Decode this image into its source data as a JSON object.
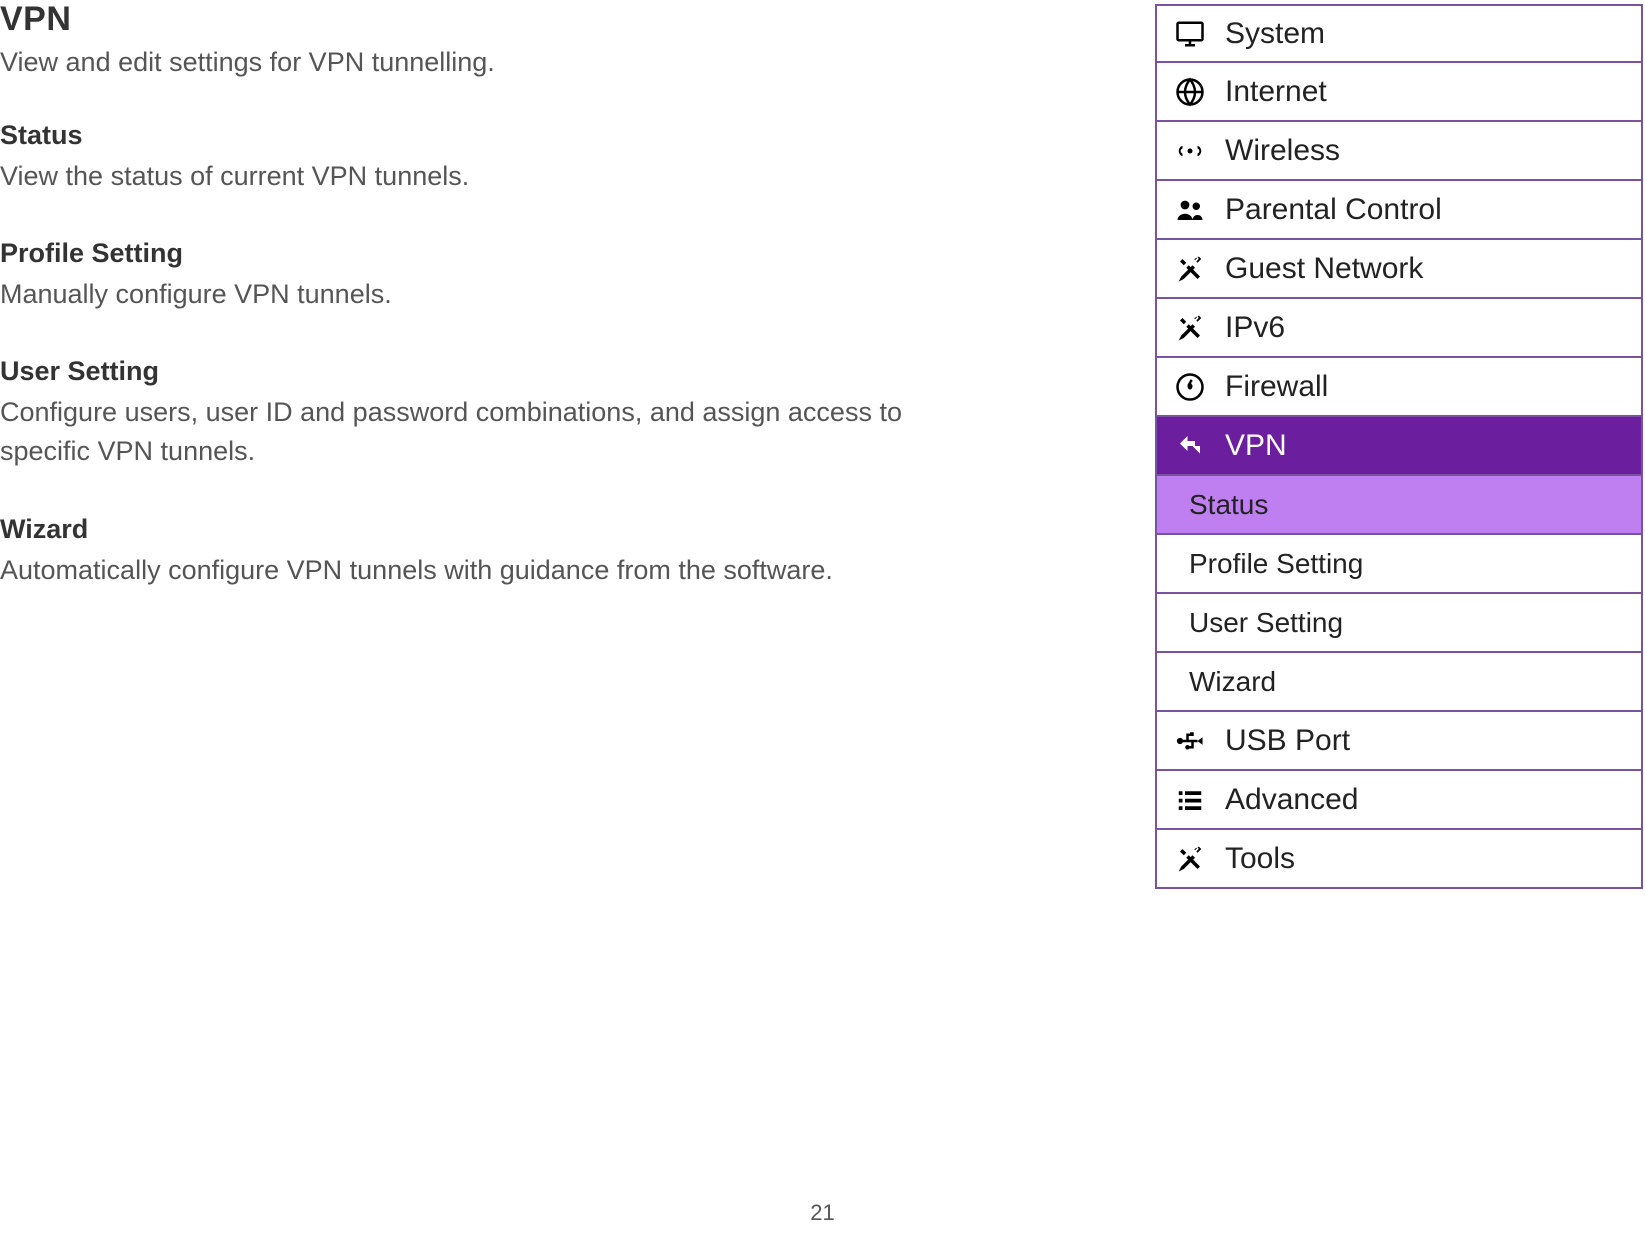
{
  "page": {
    "title": "VPN",
    "subtitle": "View and edit settings for VPN tunnelling.",
    "number": "21"
  },
  "sections": [
    {
      "heading": "Status",
      "desc": "View the status of current VPN tunnels."
    },
    {
      "heading": "Profile Setting",
      "desc": "Manually configure VPN tunnels."
    },
    {
      "heading": "User Setting",
      "desc": "Configure users, user ID and password combinations, and assign access to specific VPN tunnels."
    },
    {
      "heading": "Wizard",
      "desc": "Automatically configure VPN tunnels with guidance from the software."
    }
  ],
  "nav": {
    "items": [
      {
        "icon": "monitor-icon",
        "label": "System"
      },
      {
        "icon": "globe-icon",
        "label": "Internet"
      },
      {
        "icon": "wifi-icon",
        "label": "Wireless"
      },
      {
        "icon": "users-icon",
        "label": "Parental Control"
      },
      {
        "icon": "tools-icon",
        "label": "Guest Network"
      },
      {
        "icon": "tools-icon",
        "label": "IPv6"
      },
      {
        "icon": "firewall-icon",
        "label": "Firewall"
      }
    ],
    "active": {
      "icon": "vpn-icon",
      "label": "VPN"
    },
    "sub": [
      {
        "label": "Status",
        "active": true
      },
      {
        "label": "Profile Setting",
        "active": false
      },
      {
        "label": "User Setting",
        "active": false
      },
      {
        "label": "Wizard",
        "active": false
      }
    ],
    "items_after": [
      {
        "icon": "usb-icon",
        "label": "USB Port"
      },
      {
        "icon": "list-icon",
        "label": "Advanced"
      },
      {
        "icon": "tools-icon",
        "label": "Tools"
      }
    ]
  }
}
